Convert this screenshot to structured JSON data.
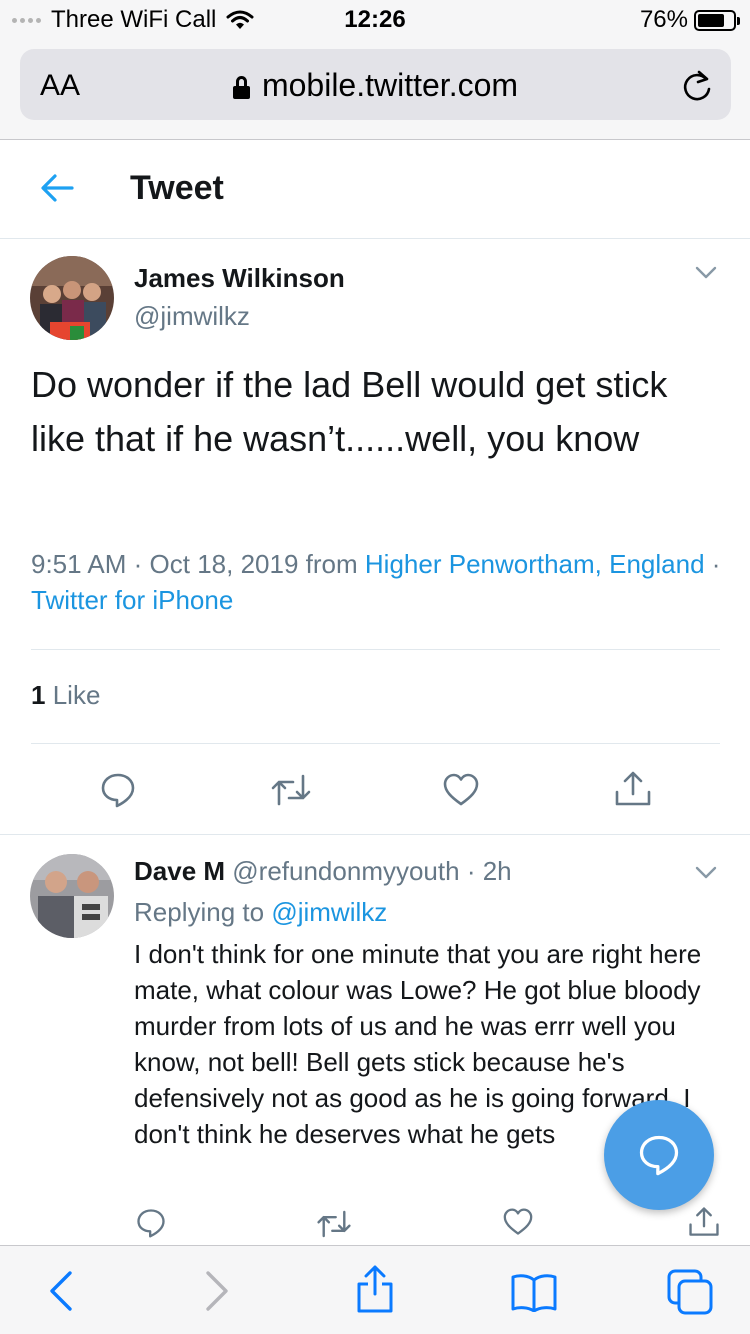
{
  "status_bar": {
    "carrier": "Three WiFi Call",
    "time": "12:26",
    "battery": "76%",
    "battery_level": 0.76
  },
  "browser": {
    "text_size_label": "AA",
    "url": "mobile.twitter.com"
  },
  "header": {
    "title": "Tweet"
  },
  "tweet": {
    "author_name": "James Wilkinson",
    "author_handle": "@jimwilkz",
    "text": "Do wonder if the lad Bell would get stick like that if he wasn’t......well, you know",
    "time": "9:51 AM",
    "date": "Oct 18, 2019",
    "from_label": "from",
    "location": "Higher Penwortham, England",
    "separator": "·",
    "client": "Twitter for iPhone",
    "like_count": "1",
    "like_label": "Like"
  },
  "reply": {
    "author_name": "Dave M",
    "author_handle": "@refundonmyyouth",
    "separator": "·",
    "age": "2h",
    "replying_to_label": "Replying to",
    "replying_to_handle": "@jimwilkz",
    "text": "I don't think for one minute that you are right here mate, what colour was Lowe? He got blue bloody murder from lots of us and he was errr well you know, not bell! Bell gets stick because he's defensively not as good as he is going forward, I don't think he deserves what he gets"
  },
  "colors": {
    "accent": "#1b95e0",
    "secondary_text": "#657786",
    "fab": "#4b9ee6",
    "browser_blue": "#0a7aff"
  }
}
